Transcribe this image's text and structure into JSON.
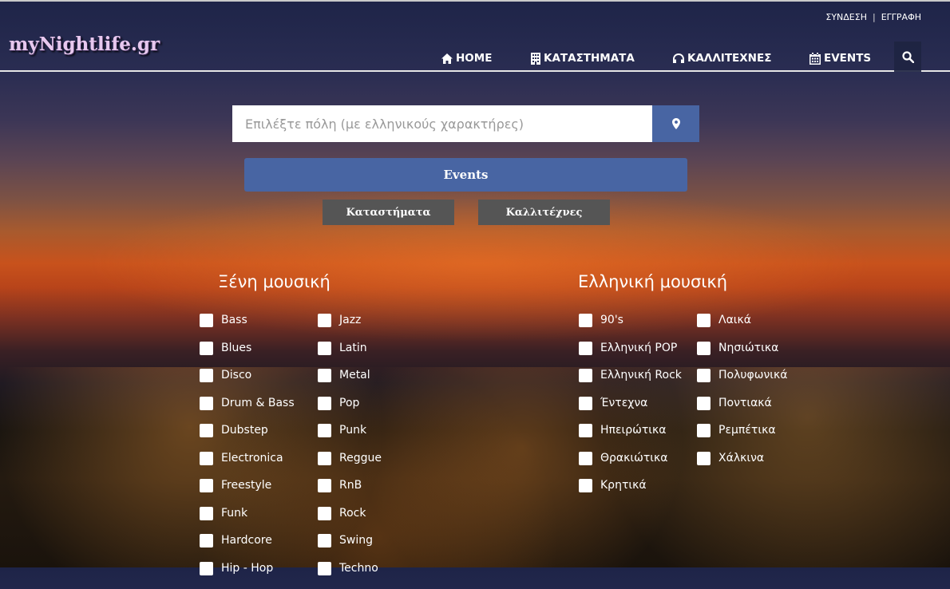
{
  "header": {
    "logo": "myNightlife.gr",
    "auth": {
      "login": "ΣΥΝΔΕΣΗ",
      "separator": "|",
      "register": "ΕΓΓΡΑΦΗ"
    },
    "nav": [
      {
        "label": "HOME",
        "icon": "home-icon"
      },
      {
        "label": "ΚΑΤΑΣΤΗΜΑΤΑ",
        "icon": "building-icon"
      },
      {
        "label": "ΚΑΛΛΙΤΕΧΝΕΣ",
        "icon": "headphones-icon"
      },
      {
        "label": "EVENTS",
        "icon": "calendar-icon"
      }
    ],
    "search_icon": "search-icon"
  },
  "search": {
    "placeholder": "Επιλέξτε πόλη (με ελληνικούς χαρακτήρες)",
    "value": "",
    "location_icon": "map-marker-icon",
    "events_label": "Events",
    "stores_label": "Καταστήματα",
    "artists_label": "Καλλιτέχνες"
  },
  "foreign_music": {
    "title": "Ξένη μουσική",
    "col1": [
      "Bass",
      "Blues",
      "Disco",
      "Drum & Bass",
      "Dubstep",
      "Electronica",
      "Freestyle",
      "Funk",
      "Hardcore",
      "Hip - Hop"
    ],
    "col2": [
      "Jazz",
      "Latin",
      "Metal",
      "Pop",
      "Punk",
      "Reggue",
      "RnB",
      "Rock",
      "Swing",
      "Techno"
    ]
  },
  "greek_music": {
    "title": "Ελληνική μουσική",
    "col1": [
      "90's",
      "Ελληνική POP",
      "Ελληνική Rock",
      "Έντεχνα",
      "Ηπειρώτικα",
      "Θρακιώτικα",
      "Κρητικά"
    ],
    "col2": [
      "Λαικά",
      "Νησιώτικα",
      "Πολυφωνικά",
      "Ποντιακά",
      "Ρεμπέτικα",
      "Χάλκινα"
    ]
  },
  "colors": {
    "accent": "#4865a3",
    "secondary_button": "#555555"
  }
}
